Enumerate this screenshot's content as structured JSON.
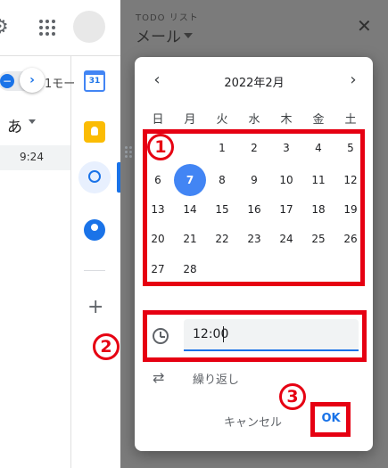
{
  "left_app": {
    "mode_text": "1モー",
    "kana": "あ",
    "row_time": "9:24",
    "icons": [
      "gear-icon",
      "apps-grid-icon",
      "avatar",
      "calendar-icon",
      "keep-icon",
      "tasks-icon",
      "contacts-icon",
      "plus-icon"
    ],
    "calendar_icon_text": "31"
  },
  "panel": {
    "subtitle": "TODO リスト",
    "title": "メール"
  },
  "date_picker": {
    "month_label": "2022年2月",
    "weekdays": [
      "日",
      "月",
      "火",
      "水",
      "木",
      "金",
      "土"
    ],
    "selected_day": "7",
    "weeks": [
      [
        "",
        "",
        "1",
        "2",
        "3",
        "4",
        "5"
      ],
      [
        "6",
        "7",
        "8",
        "9",
        "10",
        "11",
        "12"
      ],
      [
        "13",
        "14",
        "15",
        "16",
        "17",
        "18",
        "19"
      ],
      [
        "20",
        "21",
        "22",
        "23",
        "24",
        "25",
        "26"
      ],
      [
        "27",
        "28",
        "",
        "",
        "",
        "",
        ""
      ]
    ]
  },
  "time_field": {
    "value": "12:00"
  },
  "repeat_label": "繰り返し",
  "buttons": {
    "cancel": "キャンセル",
    "ok": "OK"
  },
  "annotations": {
    "n1": "1",
    "n2": "2",
    "n3": "3"
  },
  "colors": {
    "accent": "#1a73e8",
    "selected": "#4285f4",
    "annotation_red": "#e60012"
  }
}
